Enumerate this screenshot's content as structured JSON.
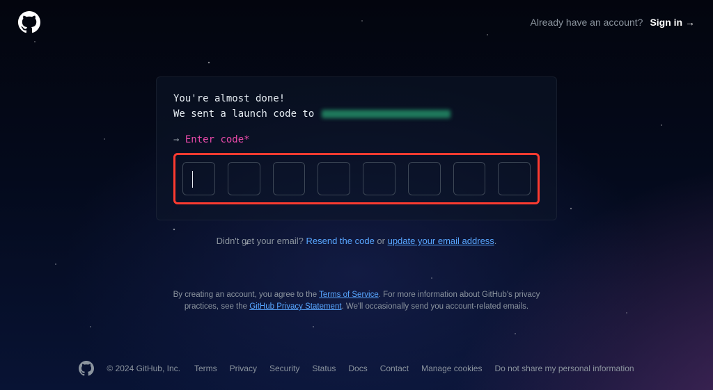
{
  "header": {
    "already": "Already have an account?",
    "signin": "Sign in →"
  },
  "card": {
    "line1": "You're almost done!",
    "line2_prefix": "We sent a launch code to",
    "arrow": "→",
    "enter_label": "Enter code*"
  },
  "resend": {
    "prefix": "Didn't get your email? ",
    "resend_link": "Resend the code",
    "or": " or ",
    "update_link": "update your email address",
    "suffix": "."
  },
  "legal": {
    "t1": "By creating an account, you agree to the ",
    "tos": "Terms of Service",
    "t2": ". For more information about GitHub's privacy practices, see the ",
    "privacy": "GitHub Privacy Statement",
    "t3": ". We'll occasionally send you account-related emails."
  },
  "footer": {
    "copyright": "© 2024 GitHub, Inc.",
    "links": [
      "Terms",
      "Privacy",
      "Security",
      "Status",
      "Docs",
      "Contact",
      "Manage cookies",
      "Do not share my personal information"
    ]
  }
}
